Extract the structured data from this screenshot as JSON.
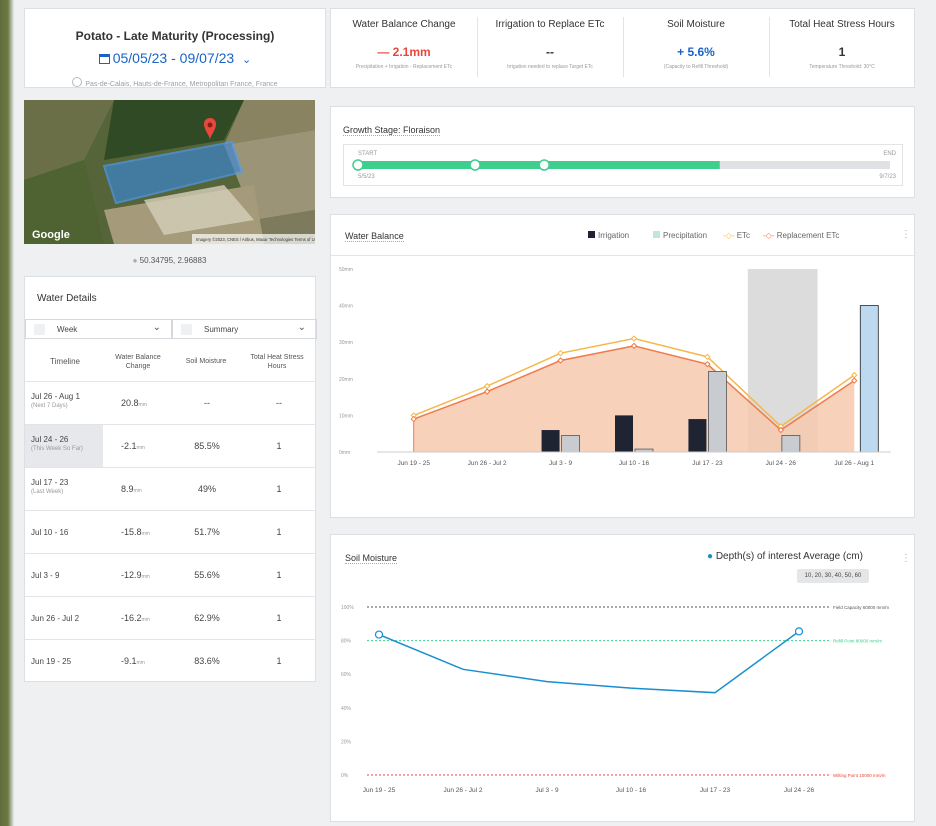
{
  "header": {
    "title": "Potato - Late Maturity (Processing)",
    "date_range": "05/05/23 - 09/07/23",
    "location": "Pas-de-Calais, Hauts-de-France, Metropolitan France, France"
  },
  "map": {
    "provider": "Google",
    "attribution": "Imagery ©2023, CNES / Airbus, Maxar Technologies   Terms of Use"
  },
  "coordinates": "50.34795, 2.96883",
  "water_details": {
    "title": "Water Details",
    "period_select": "Week",
    "view_select": "Summary",
    "columns": [
      "Timeline",
      "Water Balance Change",
      "Soil Moisture",
      "Total Heat Stress Hours"
    ],
    "rows": [
      {
        "timeline": "Jul 26 - Aug 1",
        "sub": "(Next 7 Days)",
        "wbc": "20.8",
        "unit": "mm",
        "soil": "--",
        "heat": "--",
        "highlight": false
      },
      {
        "timeline": "Jul 24 - 26",
        "sub": "(This Week So Far)",
        "wbc": "-2.1",
        "unit": "mm",
        "soil": "85.5%",
        "heat": "1",
        "highlight": true
      },
      {
        "timeline": "Jul 17 - 23",
        "sub": "(Last Week)",
        "wbc": "8.9",
        "unit": "mm",
        "soil": "49%",
        "heat": "1",
        "highlight": false
      },
      {
        "timeline": "Jul 10 - 16",
        "sub": "",
        "wbc": "-15.8",
        "unit": "mm",
        "soil": "51.7%",
        "heat": "1",
        "highlight": false
      },
      {
        "timeline": "Jul 3 - 9",
        "sub": "",
        "wbc": "-12.9",
        "unit": "mm",
        "soil": "55.6%",
        "heat": "1",
        "highlight": false
      },
      {
        "timeline": "Jun 26 - Jul 2",
        "sub": "",
        "wbc": "-16.2",
        "unit": "mm",
        "soil": "62.9%",
        "heat": "1",
        "highlight": false
      },
      {
        "timeline": "Jun 19 - 25",
        "sub": "",
        "wbc": "-9.1",
        "unit": "mm",
        "soil": "83.6%",
        "heat": "1",
        "highlight": false
      }
    ]
  },
  "stats": [
    {
      "title": "Water Balance Change",
      "value": "— 2.1mm",
      "sub": "Precipitation + Irrigation - Replacement ETc",
      "sign_color": "#e8483b"
    },
    {
      "title": "Irrigation to Replace ETc",
      "value": "--",
      "sub": "Irrigation needed to replace Target ETc",
      "sign_color": "#333333"
    },
    {
      "title": "Soil Moisture",
      "value": "+ 5.6%",
      "sub": "(Capacity to Refill Threshold)",
      "sign_color": "#1a63c6"
    },
    {
      "title": "Total Heat Stress Hours",
      "value": "1",
      "sub": "Temperature Threshold: 30°C",
      "sign_color": "#333333"
    }
  ],
  "growth": {
    "title": "Growth Stage: Floraison",
    "start_label": "START",
    "end_label": "END",
    "start_date": "5/5/23",
    "end_date": "9/7/23",
    "progress": 0.68,
    "milestones": [
      0.0,
      0.22,
      0.35
    ]
  },
  "water_balance": {
    "title": "Water Balance",
    "legend": [
      "Irrigation",
      "Precipitation",
      "ETc",
      "Replacement ETc"
    ],
    "colors": {
      "irrigation": "#1f2433",
      "precipitation": "#c8cbd0",
      "etc": "#f5b74a",
      "replacement": "#f07a4a",
      "forecast_bar": "#bcd9ef"
    },
    "chart_data": {
      "type": "bar",
      "categories": [
        "Jun 19 - 25",
        "Jun 26 - Jul 2",
        "Jul 3 - 9",
        "Jul 10 - 16",
        "Jul 17 - 23",
        "Jul 24 - 26",
        "Jul 26 - Aug 1"
      ],
      "y_ticks": [
        "0mm",
        "10mm",
        "20mm",
        "30mm",
        "40mm",
        "50mm"
      ],
      "ylim": [
        0,
        50
      ],
      "series": [
        {
          "name": "Irrigation",
          "values": [
            0,
            0,
            6,
            10,
            9,
            0,
            0
          ]
        },
        {
          "name": "Precipitation",
          "values": [
            0,
            0,
            4.5,
            0.8,
            22,
            4.5,
            40
          ]
        },
        {
          "name": "ETc",
          "values": [
            10,
            18,
            27,
            31,
            26,
            7,
            21
          ]
        },
        {
          "name": "Replacement ETc",
          "values": [
            9,
            16.5,
            25,
            29,
            24,
            6,
            19.5
          ]
        }
      ],
      "shaded_category": "Jul 24 - 26"
    }
  },
  "soil_moisture": {
    "title": "Soil Moisture",
    "legend": "Depth(s) of interest Average (cm)",
    "depths": "10, 20, 30, 40, 50, 60",
    "field_capacity_label": "Field Capacity 60000 mm/m",
    "refill_label": "Refill Point 80000 mm/m",
    "wilting_label": "Wilting Point 10000 mm/m",
    "chart_data": {
      "type": "line",
      "x": [
        "Jun 19 - 25",
        "Jun 26 - Jul 2",
        "Jul 3 - 9",
        "Jul 10 - 16",
        "Jul 17 - 23",
        "Jul 24 - 26"
      ],
      "y_ticks": [
        "0%",
        "20%",
        "40%",
        "60%",
        "80%",
        "100%"
      ],
      "ylim": [
        0,
        100
      ],
      "series": [
        {
          "name": "Depth(s) of interest Average (cm)",
          "values": [
            83.6,
            62.9,
            55.6,
            51.7,
            49,
            85.5
          ]
        }
      ],
      "reference_lines": {
        "field_capacity": 100,
        "refill_point": 80,
        "wilting_point": 0
      }
    }
  }
}
